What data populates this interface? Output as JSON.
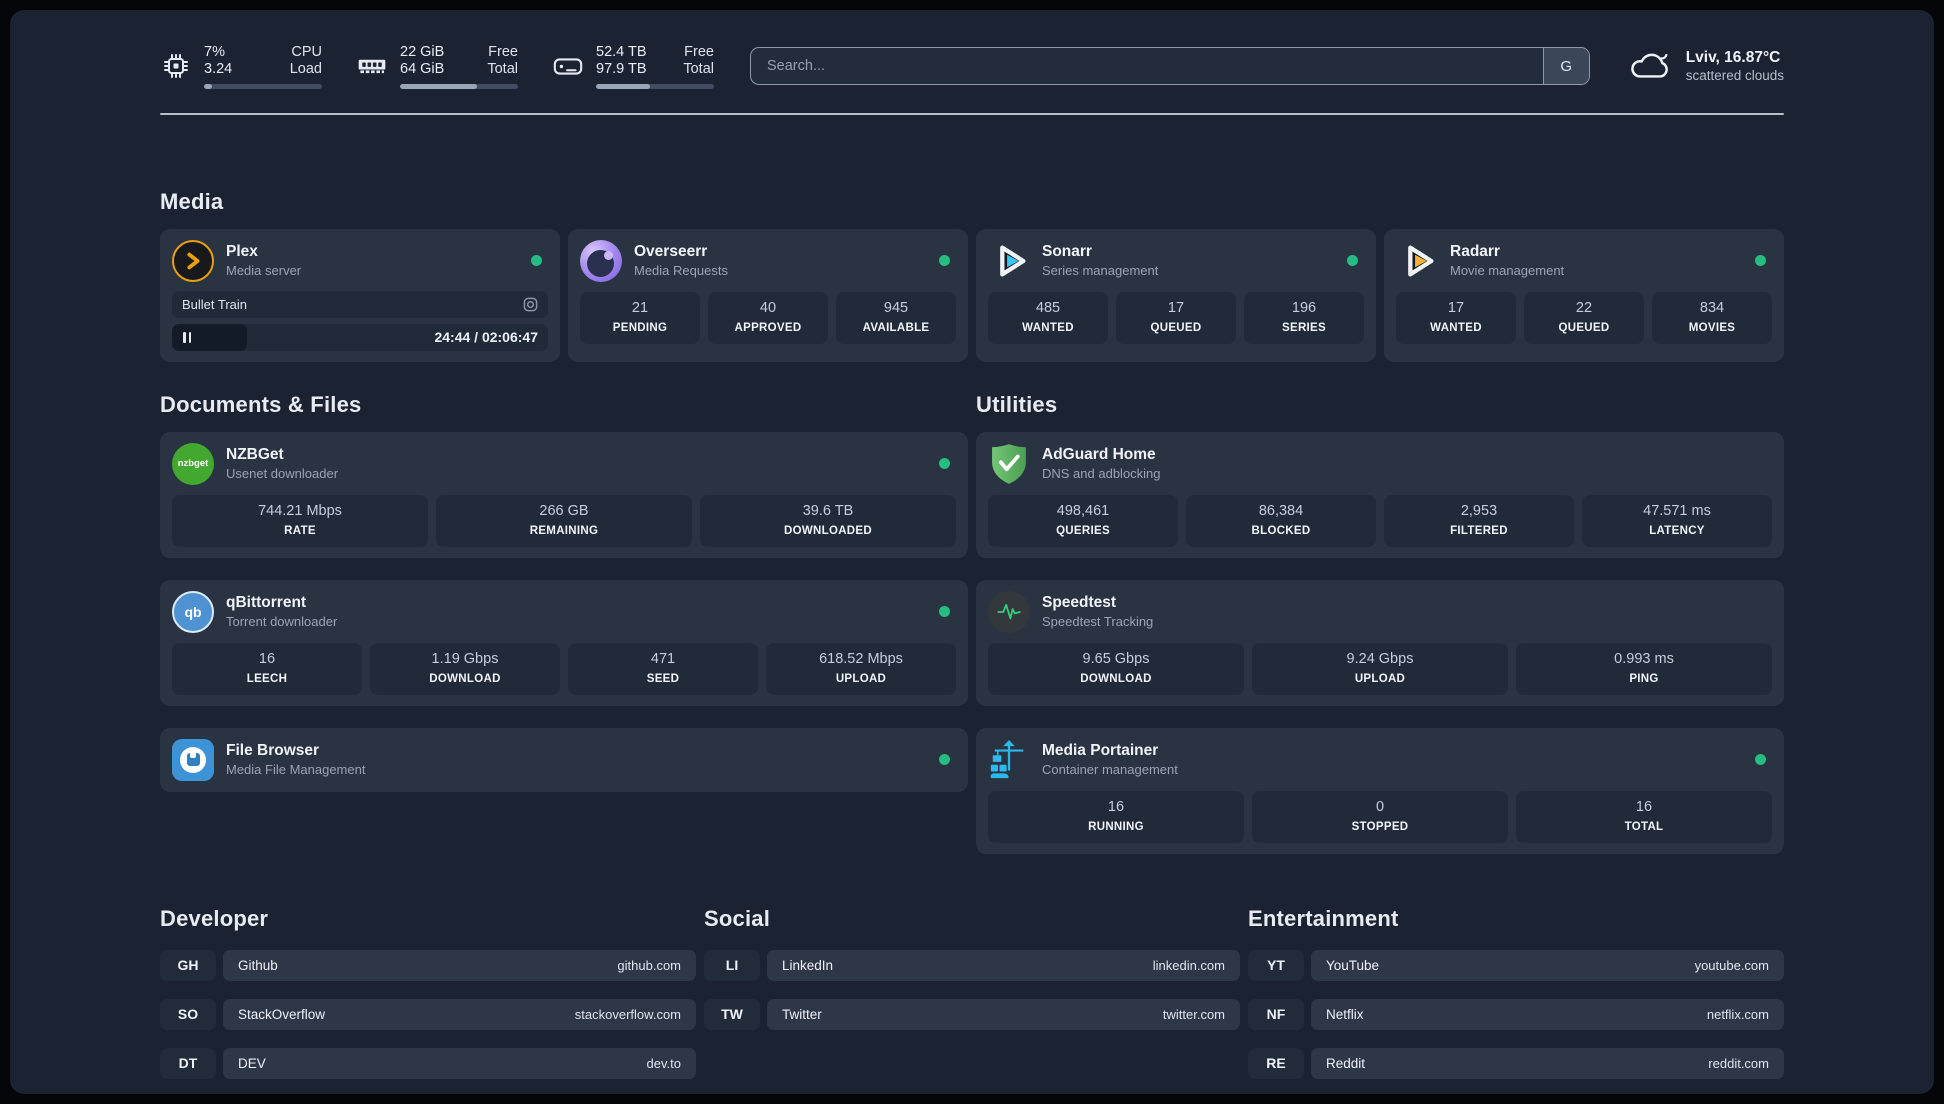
{
  "header": {
    "cpu": {
      "value_line1": "7%",
      "value_line2": "3.24",
      "label_line1": "CPU",
      "label_line2": "Load",
      "progress": 7
    },
    "memory": {
      "value_line1": "22 GiB",
      "value_line2": "64 GiB",
      "label_line1": "Free",
      "label_line2": "Total",
      "progress": 65
    },
    "disk": {
      "value_line1": "52.4 TB",
      "value_line2": "97.9 TB",
      "label_line1": "Free",
      "label_line2": "Total",
      "progress": 46
    },
    "search": {
      "placeholder": "Search...",
      "engine_button": "G"
    },
    "weather": {
      "location": "Lviv, 16.87°C",
      "condition": "scattered clouds"
    }
  },
  "sections": {
    "media": "Media",
    "documents": "Documents & Files",
    "utilities": "Utilities",
    "developer": "Developer",
    "social": "Social",
    "entertainment": "Entertainment"
  },
  "apps": {
    "plex": {
      "name": "Plex",
      "description": "Media server",
      "status": "online",
      "now_playing": {
        "title": "Bullet Train",
        "time": "24:44 / 02:06:47",
        "progress": 20
      }
    },
    "overseerr": {
      "name": "Overseerr",
      "description": "Media Requests",
      "status": "online",
      "stats": [
        {
          "value": "21",
          "label": "PENDING"
        },
        {
          "value": "40",
          "label": "APPROVED"
        },
        {
          "value": "945",
          "label": "AVAILABLE"
        }
      ]
    },
    "sonarr": {
      "name": "Sonarr",
      "description": "Series management",
      "status": "online",
      "stats": [
        {
          "value": "485",
          "label": "WANTED"
        },
        {
          "value": "17",
          "label": "QUEUED"
        },
        {
          "value": "196",
          "label": "SERIES"
        }
      ]
    },
    "radarr": {
      "name": "Radarr",
      "description": "Movie management",
      "status": "online",
      "stats": [
        {
          "value": "17",
          "label": "WANTED"
        },
        {
          "value": "22",
          "label": "QUEUED"
        },
        {
          "value": "834",
          "label": "MOVIES"
        }
      ]
    },
    "nzbget": {
      "name": "NZBGet",
      "description": "Usenet downloader",
      "icon_text": "nzbget",
      "status": "online",
      "stats": [
        {
          "value": "744.21 Mbps",
          "label": "RATE"
        },
        {
          "value": "266 GB",
          "label": "REMAINING"
        },
        {
          "value": "39.6 TB",
          "label": "DOWNLOADED"
        }
      ]
    },
    "qbittorrent": {
      "name": "qBittorrent",
      "description": "Torrent downloader",
      "icon_text": "qb",
      "status": "online",
      "stats": [
        {
          "value": "16",
          "label": "LEECH"
        },
        {
          "value": "1.19 Gbps",
          "label": "DOWNLOAD"
        },
        {
          "value": "471",
          "label": "SEED"
        },
        {
          "value": "618.52 Mbps",
          "label": "UPLOAD"
        }
      ]
    },
    "filebrowser": {
      "name": "File Browser",
      "description": "Media File Management",
      "status": "online"
    },
    "adguard": {
      "name": "AdGuard Home",
      "description": "DNS and adblocking",
      "stats": [
        {
          "value": "498,461",
          "label": "QUERIES"
        },
        {
          "value": "86,384",
          "label": "BLOCKED"
        },
        {
          "value": "2,953",
          "label": "FILTERED"
        },
        {
          "value": "47.571 ms",
          "label": "LATENCY"
        }
      ]
    },
    "speedtest": {
      "name": "Speedtest",
      "description": "Speedtest Tracking",
      "stats": [
        {
          "value": "9.65 Gbps",
          "label": "DOWNLOAD"
        },
        {
          "value": "9.24 Gbps",
          "label": "UPLOAD"
        },
        {
          "value": "0.993 ms",
          "label": "PING"
        }
      ]
    },
    "portainer": {
      "name": "Media Portainer",
      "description": "Container management",
      "status": "online",
      "stats": [
        {
          "value": "16",
          "label": "RUNNING"
        },
        {
          "value": "0",
          "label": "STOPPED"
        },
        {
          "value": "16",
          "label": "TOTAL"
        }
      ]
    }
  },
  "links": {
    "developer": [
      {
        "abbr": "GH",
        "name": "Github",
        "url": "github.com"
      },
      {
        "abbr": "SO",
        "name": "StackOverflow",
        "url": "stackoverflow.com"
      },
      {
        "abbr": "DT",
        "name": "DEV",
        "url": "dev.to"
      }
    ],
    "social": [
      {
        "abbr": "LI",
        "name": "LinkedIn",
        "url": "linkedin.com"
      },
      {
        "abbr": "TW",
        "name": "Twitter",
        "url": "twitter.com"
      }
    ],
    "entertainment": [
      {
        "abbr": "YT",
        "name": "YouTube",
        "url": "youtube.com"
      },
      {
        "abbr": "NF",
        "name": "Netflix",
        "url": "netflix.com"
      },
      {
        "abbr": "RE",
        "name": "Reddit",
        "url": "reddit.com"
      }
    ]
  },
  "colors": {
    "status_online": "#26bd83",
    "accent_plex": "#e9a00b",
    "accent_sonarr": "#37c6f4",
    "accent_radarr": "#fdb334",
    "accent_nzbget": "#42a82f",
    "accent_qbittorrent": "#4f92d1",
    "accent_adguard": "#5eb95e",
    "accent_speedtest": "#2ed47e",
    "accent_filebrowser": "#3d93d8",
    "accent_portainer": "#2cb9ec"
  }
}
